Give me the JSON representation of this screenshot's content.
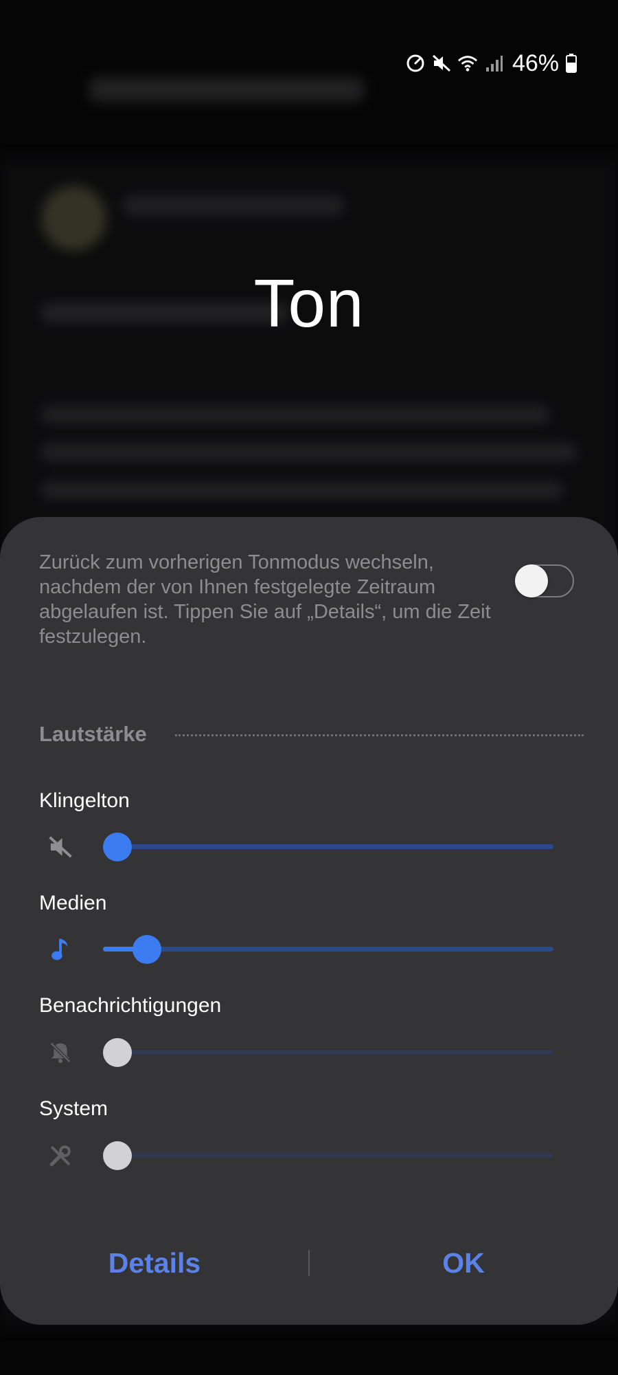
{
  "status_bar": {
    "battery_percent": "46%",
    "icons": [
      "data-saver-icon",
      "mute-icon",
      "wifi-icon",
      "signal-icon",
      "battery-icon"
    ]
  },
  "dialog": {
    "title": "Ton",
    "revert_description": "Zurück zum vorherigen Tonmodus wechseln, nachdem der von Ihnen festgelegte Zeitraum abgelaufen ist. Tippen Sie auf „Details“, um die Zeit festzulegen.",
    "revert_toggle_on": false,
    "volume_section_title": "Lautstärke",
    "volumes": [
      {
        "label": "Klingelton",
        "icon": "mute-icon",
        "level": 0.0,
        "enabled": true
      },
      {
        "label": "Medien",
        "icon": "music-note-icon",
        "level": 0.07,
        "enabled": true
      },
      {
        "label": "Benachrichtigungen",
        "icon": "notification-muted-icon",
        "level": 0.0,
        "enabled": false
      },
      {
        "label": "System",
        "icon": "system-tools-icon",
        "level": 0.0,
        "enabled": false
      }
    ],
    "details_label": "Details",
    "ok_label": "OK"
  },
  "colors": {
    "accent": "#3b7df0",
    "button_text": "#5b82e9",
    "sheet_bg": "#343436"
  }
}
